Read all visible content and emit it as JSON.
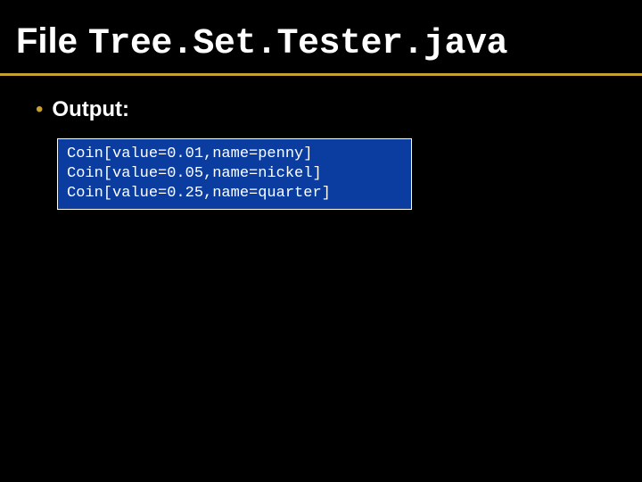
{
  "title": {
    "prefix": "File",
    "filename": "Tree.Set.Tester.java"
  },
  "bullet": {
    "marker": "•",
    "label": "Output:"
  },
  "output": {
    "lines": [
      "Coin[value=0.01,name=penny]",
      "Coin[value=0.05,name=nickel]",
      "Coin[value=0.25,name=quarter]"
    ]
  },
  "colors": {
    "accent": "#c8a030",
    "box_bg": "#0b3ca0"
  }
}
